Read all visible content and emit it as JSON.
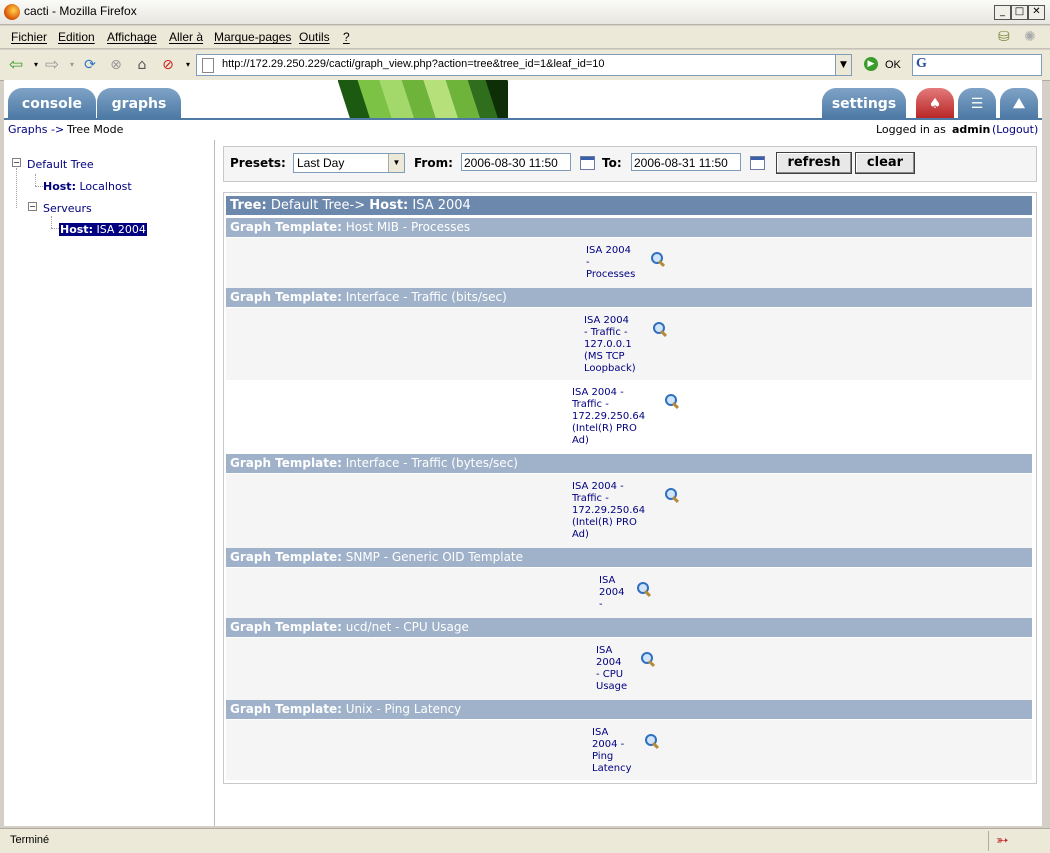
{
  "window": {
    "title": "cacti - Mozilla Firefox"
  },
  "menu": [
    "Fichier",
    "Edition",
    "Affichage",
    "Aller à",
    "Marque-pages",
    "Outils",
    "?"
  ],
  "nav": {
    "url": "http://172.29.250.229/cacti/graph_view.php?action=tree&tree_id=1&leaf_id=10",
    "go_label": "OK"
  },
  "tabs": {
    "console": "console",
    "graphs": "graphs",
    "settings": "settings"
  },
  "breadcrumb": {
    "graphs": "Graphs",
    "arrow": "->",
    "current": "Tree Mode"
  },
  "login": {
    "prefix": "Logged in as",
    "user": "admin",
    "logout": "(Logout)"
  },
  "tree": {
    "root": "Default Tree",
    "items": [
      {
        "prefix": "Host:",
        "label": "Localhost"
      },
      {
        "prefix": "",
        "label": "Serveurs"
      },
      {
        "prefix": "Host:",
        "label": "ISA 2004"
      }
    ]
  },
  "presets": {
    "label": "Presets:",
    "value": "Last Day",
    "from_label": "From:",
    "from": "2006-08-30 11:50",
    "to_label": "To:",
    "to": "2006-08-31 11:50",
    "refresh": "refresh",
    "clear": "clear"
  },
  "path": {
    "tree_label": "Tree:",
    "tree_value": "Default Tree->",
    "host_label": "Host:",
    "host_value": "ISA 2004"
  },
  "template_label": "Graph Template:",
  "templates": [
    {
      "name": "Host MIB - Processes",
      "graphs": [
        [
          "ISA 2004",
          "-",
          "Processes"
        ]
      ]
    },
    {
      "name": "Interface - Traffic (bits/sec)",
      "graphs": [
        [
          "ISA 2004",
          "- Traffic -",
          "127.0.0.1",
          "(MS TCP",
          "Loopback)"
        ],
        [
          "ISA 2004 -",
          "Traffic -",
          "172.29.250.64",
          "(Intel(R) PRO",
          "Ad)"
        ]
      ]
    },
    {
      "name": "Interface - Traffic (bytes/sec)",
      "graphs": [
        [
          "ISA 2004 -",
          "Traffic -",
          "172.29.250.64",
          "(Intel(R) PRO",
          "Ad)"
        ]
      ]
    },
    {
      "name": "SNMP - Generic OID Template",
      "graphs": [
        [
          "ISA",
          "2004",
          "-"
        ]
      ]
    },
    {
      "name": "ucd/net - CPU Usage",
      "graphs": [
        [
          "ISA",
          "2004",
          "- CPU",
          "Usage"
        ]
      ]
    },
    {
      "name": "Unix - Ping Latency",
      "graphs": [
        [
          "ISA",
          "2004 -",
          "Ping",
          "Latency"
        ]
      ]
    }
  ],
  "status": {
    "text": "Terminé"
  }
}
